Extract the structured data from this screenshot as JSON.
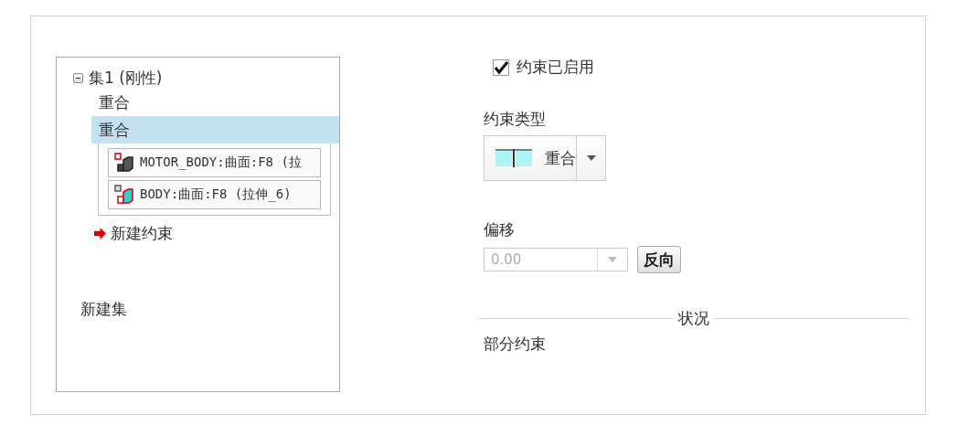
{
  "tree": {
    "label": "集1 (刚性)",
    "expanded": true,
    "children": [
      {
        "label": "重合",
        "selected": false
      },
      {
        "label": "重合",
        "selected": true,
        "references": [
          "MOTOR_BODY:曲面:F8 (拉",
          "BODY:曲面:F8 (拉伸_6)"
        ]
      }
    ]
  },
  "new_constraint": "新建约束",
  "new_set": "新建集",
  "enabled": {
    "label": "约束已启用",
    "checked": true
  },
  "type": {
    "label": "约束类型",
    "value": "重合"
  },
  "offset": {
    "label": "偏移",
    "value": "0.00",
    "disabled": true
  },
  "flip_button": "反向",
  "status": {
    "heading": "状况",
    "text": "部分约束"
  }
}
